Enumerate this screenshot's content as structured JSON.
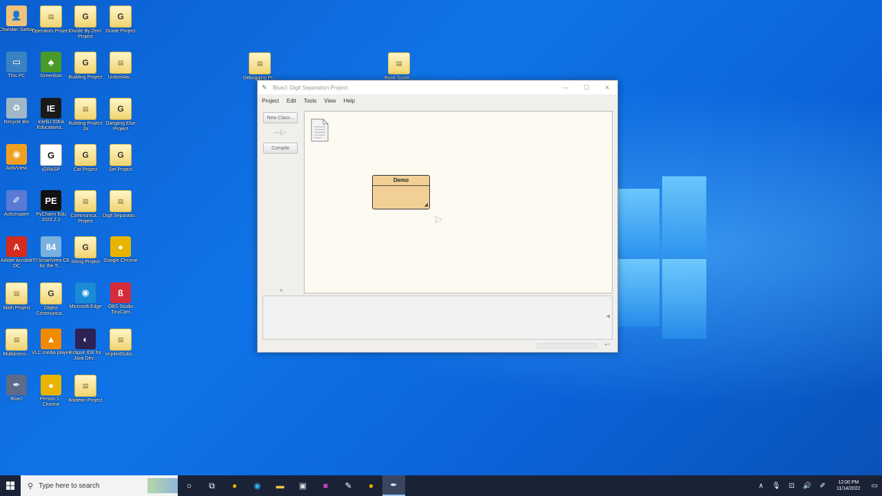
{
  "desktop_icons": [
    {
      "id": "chandan",
      "label": "Chandan Sarkar",
      "glyph": "user"
    },
    {
      "id": "operators",
      "label": "Operators Project",
      "glyph": "folder"
    },
    {
      "id": "divide",
      "label": "Divide By Zero Project",
      "glyph": "jgrasp"
    },
    {
      "id": "grade",
      "label": "Grade Project",
      "glyph": "jgrasp"
    },
    {
      "id": "thispc",
      "label": "This PC",
      "glyph": "pc"
    },
    {
      "id": "greenfoot",
      "label": "Greenfoot",
      "glyph": "greenfoot"
    },
    {
      "id": "building",
      "label": "Building Project",
      "glyph": "jgrasp"
    },
    {
      "id": "unitize",
      "label": "UnitizeAw...",
      "glyph": "folder"
    },
    {
      "id": "recycle",
      "label": "Recycle Bin",
      "glyph": "recycle"
    },
    {
      "id": "intellij",
      "label": "IntelliJ IDEA Educationa...",
      "glyph": "IE"
    },
    {
      "id": "buildingpa",
      "label": "Building Project 2a",
      "glyph": "folder"
    },
    {
      "id": "dangling",
      "label": "Dangling Else Project",
      "glyph": "jgrasp"
    },
    {
      "id": "activinspire",
      "label": "ActivView",
      "glyph": "activ"
    },
    {
      "id": "jgrasp",
      "label": "jGRASP",
      "glyph": "G"
    },
    {
      "id": "cat",
      "label": "Cat Project",
      "glyph": "jgrasp"
    },
    {
      "id": "set",
      "label": "Set Project",
      "glyph": "jgrasp"
    },
    {
      "id": "activinspire2",
      "label": "ActivInspire",
      "glyph": "inspire"
    },
    {
      "id": "pycharm",
      "label": "PyCharm Edu 2022.2.2",
      "glyph": "PE"
    },
    {
      "id": "communica",
      "label": "Communica... Project",
      "glyph": "folder"
    },
    {
      "id": "digit",
      "label": "Digit Separatio...",
      "glyph": "folder"
    },
    {
      "id": "acrobat",
      "label": "Adobe Acrobat DC",
      "glyph": "acrobat"
    },
    {
      "id": "smartview",
      "label": "TI-SmartView CE for the Ti...",
      "glyph": "84"
    },
    {
      "id": "string",
      "label": "String Project",
      "glyph": "jgrasp"
    },
    {
      "id": "chrome",
      "label": "Google Chrome",
      "glyph": "chrome"
    },
    {
      "id": "math",
      "label": "Math Project",
      "glyph": "folder"
    },
    {
      "id": "object",
      "label": "Object Communica...",
      "glyph": "jgrasp"
    },
    {
      "id": "edge",
      "label": "Microsoft Edge",
      "glyph": "edge"
    },
    {
      "id": "tinycam",
      "label": "OBS Studio TinyCam",
      "glyph": "cam"
    },
    {
      "id": "multiline",
      "label": "Multilineco...",
      "glyph": "folder"
    },
    {
      "id": "vlc",
      "label": "VLC media player",
      "glyph": "vlc"
    },
    {
      "id": "eclipse",
      "label": "Eclipse IDE for Java Dev...",
      "glyph": "eclipse"
    },
    {
      "id": "implied",
      "label": "ImpliedSubs...",
      "glyph": "folder"
    },
    {
      "id": "bluej",
      "label": "BlueJ",
      "glyph": "bluej"
    },
    {
      "id": "person1",
      "label": "Person 1 - Chrome",
      "glyph": "chrome"
    },
    {
      "id": "boolean",
      "label": "Boolean Project",
      "glyph": "folder"
    }
  ],
  "floating_icons": [
    {
      "id": "debugging",
      "label": "Debugging Pr..."
    },
    {
      "id": "bookstore",
      "label": "Book Score..."
    }
  ],
  "bluej": {
    "title": "BlueJ: Digit Separation Project",
    "controls": {
      "minimize": "—",
      "maximize": "☐",
      "close": "✕"
    },
    "menu": [
      "Project",
      "Edit",
      "Tools",
      "View",
      "Help"
    ],
    "buttons": {
      "new_class": "New Class...",
      "arrow": "—▷",
      "compile": "Compile"
    },
    "class_name": "Demo"
  },
  "taskbar": {
    "search_placeholder": "Type here to search",
    "time": "12:00 PM",
    "date": "11/14/2022"
  }
}
